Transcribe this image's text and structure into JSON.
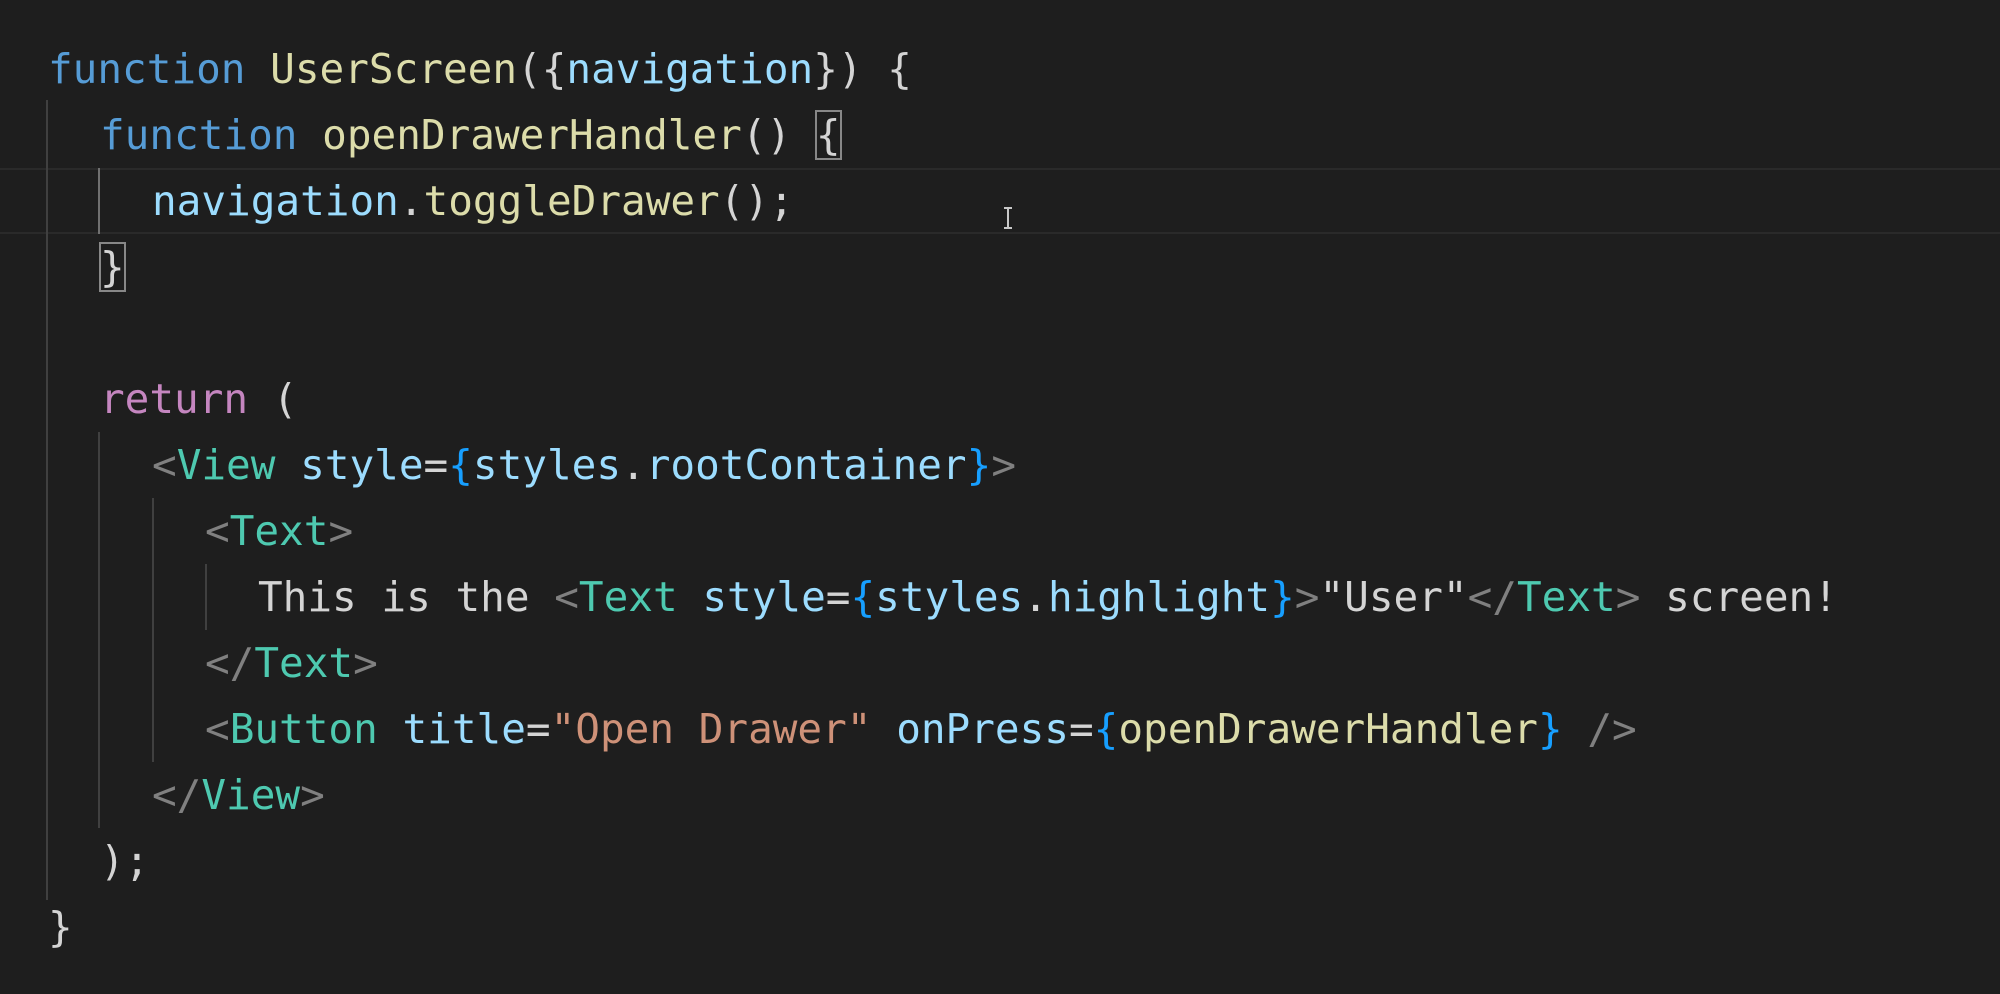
{
  "theme": {
    "background": "#1e1e1e",
    "keyword_storage": "#569cd6",
    "keyword_control": "#c586c0",
    "function_name": "#dcdcaa",
    "parameter": "#9cdcfe",
    "tag": "#4ec9b0",
    "tag_punctuation": "#808080",
    "string": "#ce9178",
    "brace": "#179fff",
    "text": "#d4d4d4"
  },
  "code": {
    "line1": {
      "keyword": "function",
      "name": "UserScreen",
      "open": "({",
      "param": "navigation",
      "close": "}) {"
    },
    "line2": {
      "keyword": "function",
      "name": "openDrawerHandler",
      "parens": "()",
      "brace": "{"
    },
    "line3": {
      "object": "navigation",
      "dot": ".",
      "method": "toggleDrawer",
      "tail": "();"
    },
    "line4": {
      "brace": "}"
    },
    "line5": {
      "keyword": "return",
      "paren": "("
    },
    "line6": {
      "lt": "<",
      "tag": "View",
      "attr": "style",
      "eq": "=",
      "lbrace": "{",
      "obj": "styles",
      "dot": ".",
      "prop": "rootContainer",
      "rbrace": "}",
      "gt": ">"
    },
    "line7": {
      "lt": "<",
      "tag": "Text",
      "gt": ">"
    },
    "line8": {
      "text": "This is the ",
      "lt": "<",
      "tag": "Text",
      "attr": "style",
      "eq": "=",
      "lbrace": "{",
      "obj": "styles",
      "dot": ".",
      "prop": "highlight",
      "rbrace": "}",
      "gt": ">",
      "inner": "\"User\"",
      "close_lt": "</",
      "close_tag": "Text",
      "close_gt": ">",
      "tail": " screen!"
    },
    "line9": {
      "lt": "</",
      "tag": "Text",
      "gt": ">"
    },
    "line10": {
      "lt": "<",
      "tag": "Button",
      "attr1": "title",
      "eq1": "=",
      "str": "\"Open Drawer\"",
      "attr2": "onPress",
      "eq2": "=",
      "lbrace": "{",
      "handler": "openDrawerHandler",
      "rbrace": "}",
      "selfclose": " />"
    },
    "line11": {
      "lt": "</",
      "tag": "View",
      "gt": ">"
    },
    "line12": {
      "text": ");"
    },
    "line13": {
      "text": "}"
    }
  },
  "mouse_cursor_icon": "text-ibeam-cursor-icon"
}
